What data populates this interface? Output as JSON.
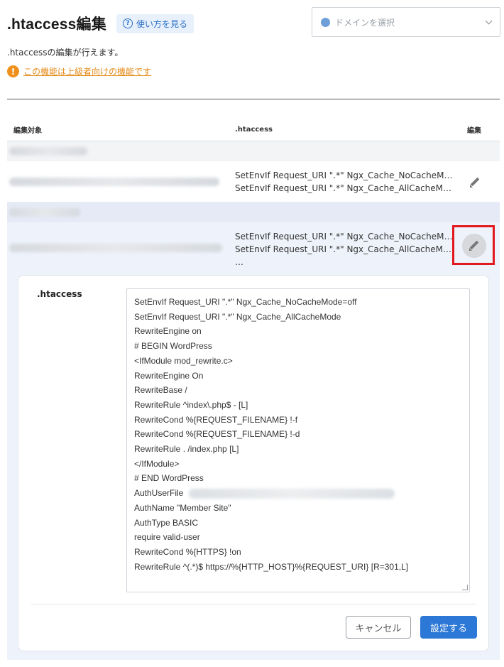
{
  "header": {
    "title": ".htaccess編集",
    "help_label": "使い方を見る"
  },
  "domain_select": {
    "placeholder": "ドメインを選択",
    "icon": "globe-icon"
  },
  "description": ".htaccessの編集が行えます。",
  "warning": {
    "icon": "exclamation-icon",
    "link_text": "この機能は上級者向けの機能です"
  },
  "table": {
    "headers": {
      "target": "編集対象",
      "htaccess": ".htaccess",
      "edit": "編集"
    },
    "rows": [
      {
        "lines": [
          "SetEnvIf Request_URI \".*\" Ngx_Cache_NoCacheM…",
          "SetEnvIf Request_URI \".*\" Ngx_Cache_AllCacheM…"
        ]
      },
      {
        "lines": [
          "SetEnvIf Request_URI \".*\" Ngx_Cache_NoCacheM…",
          "SetEnvIf Request_URI \".*\" Ngx_Cache_AllCacheM…",
          "…"
        ]
      }
    ]
  },
  "editor": {
    "label": ".htaccess",
    "lines": [
      "SetEnvIf Request_URI \".*\" Ngx_Cache_NoCacheMode=off",
      "SetEnvIf Request_URI \".*\" Ngx_Cache_AllCacheMode",
      "RewriteEngine on",
      "# BEGIN WordPress",
      "<IfModule mod_rewrite.c>",
      "RewriteEngine On",
      "RewriteBase /",
      "RewriteRule ^index\\.php$ - [L]",
      "RewriteCond %{REQUEST_FILENAME} !-f",
      "RewriteCond %{REQUEST_FILENAME} !-d",
      "RewriteRule . /index.php [L]",
      "</IfModule>",
      "# END WordPress",
      "AuthUserFile",
      "AuthName \"Member Site\"",
      "AuthType BASIC",
      "require valid-user",
      "RewriteCond %{HTTPS} !on",
      "RewriteRule ^(.*)$ https://%{HTTP_HOST}%{REQUEST_URI} [R=301,L]"
    ],
    "cancel_label": "キャンセル",
    "submit_label": "設定する"
  },
  "colors": {
    "accent": "#2b78d6",
    "warning": "#f0901c",
    "highlight": "#e2181f"
  }
}
